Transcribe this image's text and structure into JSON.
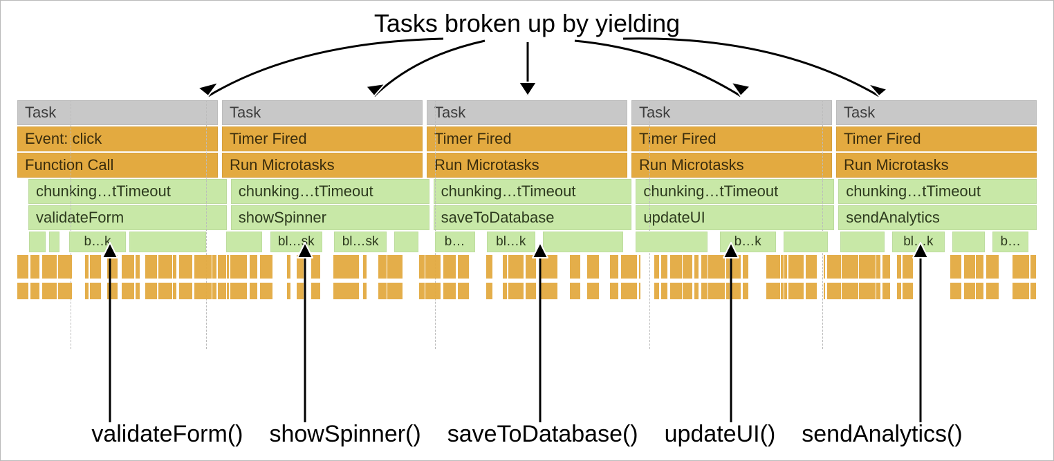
{
  "annotation_top": "Tasks broken up by yielding",
  "tasks": [
    "Task",
    "Task",
    "Task",
    "Task",
    "Task"
  ],
  "row_event": [
    "Event: click",
    "Timer Fired",
    "Timer Fired",
    "Timer Fired",
    "Timer Fired"
  ],
  "row_call": [
    "Function Call",
    "Run Microtasks",
    "Run Microtasks",
    "Run Microtasks",
    "Run Microtasks"
  ],
  "row_chunk": [
    "chunking…tTimeout",
    "chunking…tTimeout",
    "chunking…tTimeout",
    "chunking…tTimeout",
    "chunking…tTimeout"
  ],
  "row_fn": [
    "validateForm",
    "showSpinner",
    "saveToDatabase",
    "updateUI",
    "sendAnalytics"
  ],
  "mini_labels": {
    "c0": [
      "b…k"
    ],
    "c1": [
      "bl…sk",
      "bl…sk"
    ],
    "c2": [
      "b…",
      "bl…k"
    ],
    "c3": [
      "b…k"
    ],
    "c4": [
      "bl…k",
      "b…"
    ]
  },
  "bottom_labels": [
    "validateForm()",
    "showSpinner()",
    "saveToDatabase()",
    "updateUI()",
    "sendAnalytics()"
  ]
}
